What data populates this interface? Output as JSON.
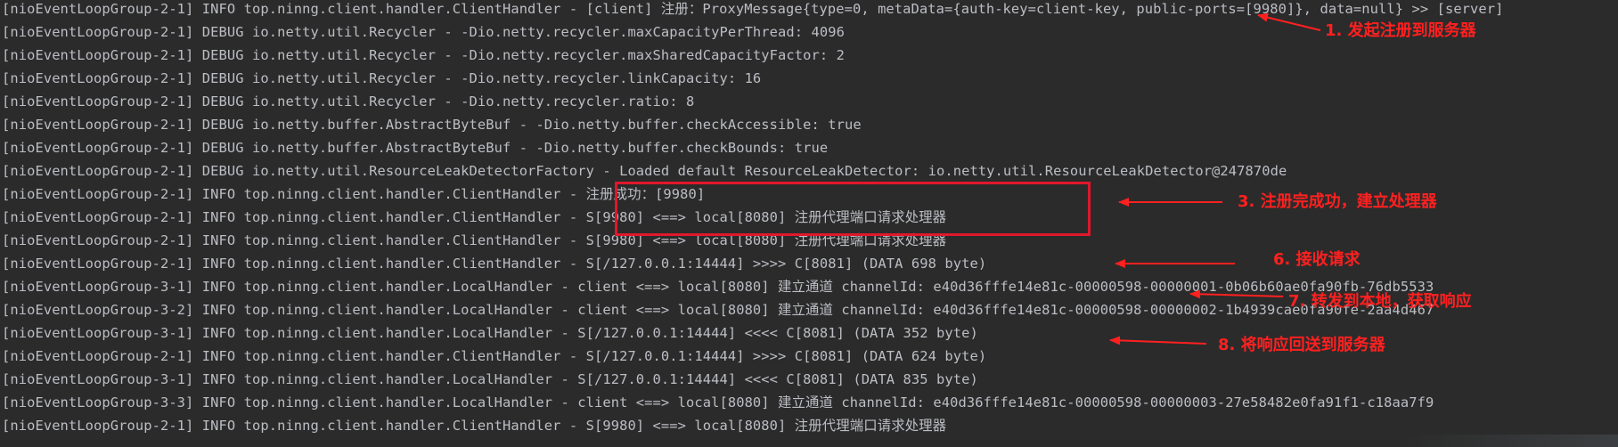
{
  "console": {
    "lines": [
      "[nioEventLoopGroup-2-1] INFO top.ninng.client.handler.ClientHandler - [client] 注册：ProxyMessage{type=0, metaData={auth-key=client-key, public-ports=[9980]}, data=null} >> [server]",
      "[nioEventLoopGroup-2-1] DEBUG io.netty.util.Recycler - -Dio.netty.recycler.maxCapacityPerThread: 4096",
      "[nioEventLoopGroup-2-1] DEBUG io.netty.util.Recycler - -Dio.netty.recycler.maxSharedCapacityFactor: 2",
      "[nioEventLoopGroup-2-1] DEBUG io.netty.util.Recycler - -Dio.netty.recycler.linkCapacity: 16",
      "[nioEventLoopGroup-2-1] DEBUG io.netty.util.Recycler - -Dio.netty.recycler.ratio: 8",
      "[nioEventLoopGroup-2-1] DEBUG io.netty.buffer.AbstractByteBuf - -Dio.netty.buffer.checkAccessible: true",
      "[nioEventLoopGroup-2-1] DEBUG io.netty.buffer.AbstractByteBuf - -Dio.netty.buffer.checkBounds: true",
      "[nioEventLoopGroup-2-1] DEBUG io.netty.util.ResourceLeakDetectorFactory - Loaded default ResourceLeakDetector: io.netty.util.ResourceLeakDetector@247870de",
      "[nioEventLoopGroup-2-1] INFO top.ninng.client.handler.ClientHandler - 注册成功：[9980]",
      "[nioEventLoopGroup-2-1] INFO top.ninng.client.handler.ClientHandler - S[9980] <==> local[8080] 注册代理端口请求处理器",
      "[nioEventLoopGroup-2-1] INFO top.ninng.client.handler.ClientHandler - S[9980] <==> local[8080] 注册代理端口请求处理器",
      "[nioEventLoopGroup-2-1] INFO top.ninng.client.handler.ClientHandler - S[/127.0.0.1:14444] >>>> C[8081] (DATA 698 byte)",
      "[nioEventLoopGroup-3-1] INFO top.ninng.client.handler.LocalHandler - client <==> local[8080] 建立通道 channelId: e40d36fffe14e81c-00000598-00000001-0b06b60ae0fa90fb-76db5533",
      "[nioEventLoopGroup-3-2] INFO top.ninng.client.handler.LocalHandler - client <==> local[8080] 建立通道 channelId: e40d36fffe14e81c-00000598-00000002-1b4939cae0fa90fe-2aa4d467",
      "[nioEventLoopGroup-3-1] INFO top.ninng.client.handler.LocalHandler - S[/127.0.0.1:14444] <<<< C[8081] (DATA 352 byte)",
      "[nioEventLoopGroup-2-1] INFO top.ninng.client.handler.ClientHandler - S[/127.0.0.1:14444] >>>> C[8081] (DATA 624 byte)",
      "[nioEventLoopGroup-3-1] INFO top.ninng.client.handler.LocalHandler - S[/127.0.0.1:14444] <<<< C[8081] (DATA 835 byte)",
      "[nioEventLoopGroup-3-3] INFO top.ninng.client.handler.LocalHandler - client <==> local[8080] 建立通道 channelId: e40d36fffe14e81c-00000598-00000003-27e58482e0fa91f1-c18aa7f9",
      "[nioEventLoopGroup-2-1] INFO top.ninng.client.handler.ClientHandler - S[9980] <==> local[8080] 注册代理端口请求处理器"
    ]
  },
  "annotations": {
    "step1": "1. 发起注册到服务器",
    "step3": "3. 注册完成功，建立处理器",
    "step6": "6. 接收请求",
    "step7": "7. 转发到本地，获取响应",
    "step8": "8. 将响应回送到服务器"
  },
  "colors": {
    "background": "#2b2b2b",
    "text": "#bcbec4",
    "annotation": "#ff2020",
    "box": "#e0182c"
  }
}
